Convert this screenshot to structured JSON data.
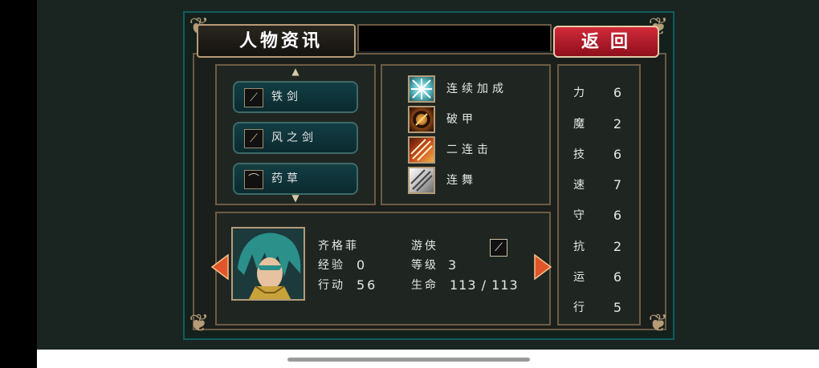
{
  "window": {
    "title": "人物资讯",
    "back_label": "返回"
  },
  "items": [
    {
      "label": "铁剑",
      "icon": "sword-icon"
    },
    {
      "label": "风之剑",
      "icon": "wind-sword-icon"
    },
    {
      "label": "药草",
      "icon": "herb-icon"
    }
  ],
  "skills": [
    {
      "label": "连续加成",
      "icon": "burst-icon"
    },
    {
      "label": "破甲",
      "icon": "armor-break-icon"
    },
    {
      "label": "二连击",
      "icon": "double-strike-icon"
    },
    {
      "label": "连舞",
      "icon": "dance-icon"
    }
  ],
  "stats": [
    {
      "name": "力",
      "value": "6"
    },
    {
      "name": "魔",
      "value": "2"
    },
    {
      "name": "技",
      "value": "6"
    },
    {
      "name": "速",
      "value": "7"
    },
    {
      "name": "守",
      "value": "6"
    },
    {
      "name": "抗",
      "value": "2"
    },
    {
      "name": "运",
      "value": "6"
    },
    {
      "name": "行",
      "value": "5"
    }
  ],
  "character": {
    "name": "齐格菲",
    "class": "游侠",
    "exp_label": "经验",
    "exp_value": "0",
    "level_label": "等级",
    "level_value": "3",
    "action_label": "行动",
    "action_value": "56",
    "hp_label": "生命",
    "hp_value": "113 / 113",
    "weapon_icon": "sword-icon"
  },
  "colors": {
    "frame_teal": "#0f5e5a",
    "gold_trim": "#b59b76",
    "back_red": "#d22a3a",
    "slot_teal": "#123e44",
    "arrow_orange": "#e0562a"
  }
}
